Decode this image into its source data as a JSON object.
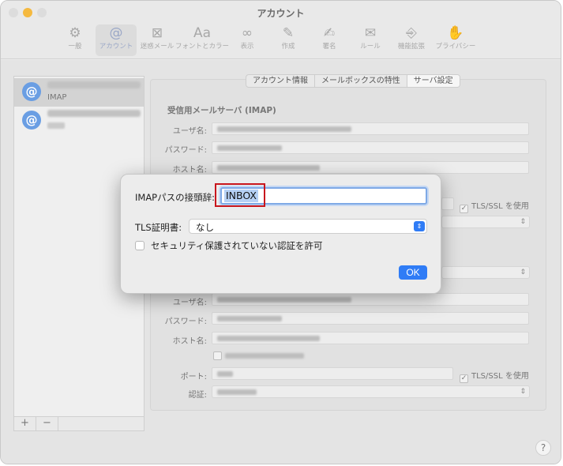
{
  "window": {
    "title": "アカウント"
  },
  "toolbar": {
    "items": [
      {
        "label": "一般",
        "icon": "gear-icon",
        "glyph": "⚙"
      },
      {
        "label": "アカウント",
        "icon": "at-icon",
        "glyph": "@"
      },
      {
        "label": "迷惑メール",
        "icon": "junk-icon",
        "glyph": "⊠"
      },
      {
        "label": "フォントとカラー",
        "icon": "font-icon",
        "glyph": "Aa"
      },
      {
        "label": "表示",
        "icon": "glasses-icon",
        "glyph": "∞"
      },
      {
        "label": "作成",
        "icon": "compose-icon",
        "glyph": "✎"
      },
      {
        "label": "署名",
        "icon": "signature-icon",
        "glyph": "✍"
      },
      {
        "label": "ルール",
        "icon": "rules-icon",
        "glyph": "✉"
      },
      {
        "label": "機能拡張",
        "icon": "extension-icon",
        "glyph": "⎆"
      },
      {
        "label": "プライバシー",
        "icon": "hand-icon",
        "glyph": "✋"
      }
    ]
  },
  "accounts": {
    "items": [
      {
        "badge": "@",
        "subtitle": "IMAP"
      },
      {
        "badge": "@",
        "subtitle": ""
      }
    ],
    "add_label": "+",
    "remove_label": "−"
  },
  "tabs": {
    "items": [
      {
        "label": "アカウント情報"
      },
      {
        "label": "メールボックスの特性"
      },
      {
        "label": "サーバ設定"
      }
    ]
  },
  "incoming": {
    "title": "受信用メールサーバ (IMAP)",
    "username_label": "ユーザ名:",
    "password_label": "パスワード:",
    "host_label": "ホスト名:",
    "tls_label": "TLS/SSL を使用"
  },
  "outgoing": {
    "username_label": "ユーザ名:",
    "password_label": "パスワード:",
    "host_label": "ホスト名:",
    "port_label": "ポート:",
    "tls_label": "TLS/SSL を使用",
    "auth_label": "認証:"
  },
  "help": {
    "label": "?"
  },
  "dialog": {
    "prefix_label": "IMAPパスの接頭辞:",
    "prefix_value": "INBOX",
    "tls_cert_label": "TLS証明書:",
    "tls_cert_value": "なし",
    "insecure_auth_label": "セキュリティ保護されていない認証を許可",
    "ok_label": "OK"
  },
  "colors": {
    "accent": "#2f7cf6",
    "highlight_border": "#c8161d",
    "account_badge": "#6a9ee3"
  }
}
